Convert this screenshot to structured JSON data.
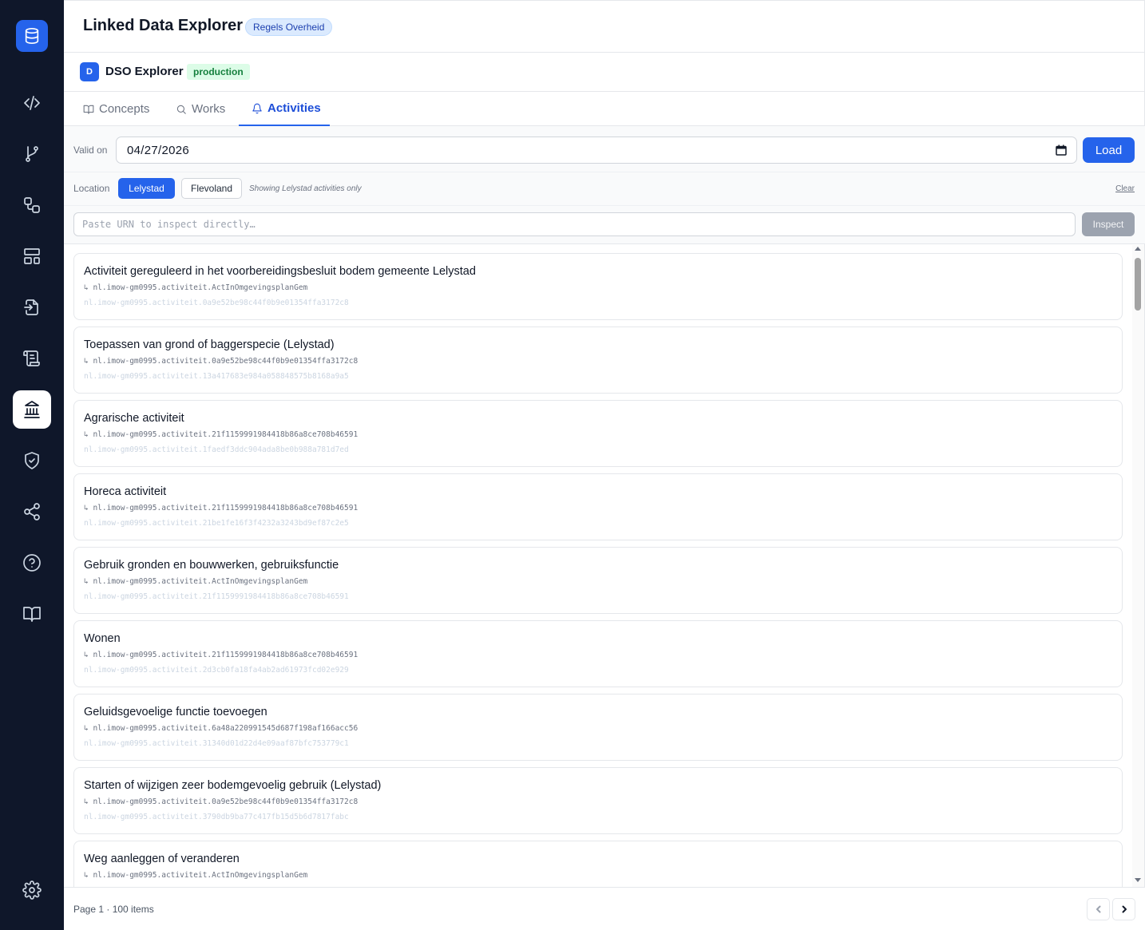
{
  "header": {
    "title": "Linked Data Explorer",
    "env_badge": "Regels Overheid"
  },
  "explorer": {
    "avatar_letter": "D",
    "name": "DSO Explorer",
    "stage_badge": "production"
  },
  "tabs": [
    {
      "label": "Concepts",
      "icon": "book-icon"
    },
    {
      "label": "Works",
      "icon": "search-icon"
    },
    {
      "label": "Activities",
      "icon": "bell-icon",
      "active": true
    }
  ],
  "controls": {
    "valid_on_label": "Valid on",
    "date_value": "04/27/2026",
    "load_label": "Load",
    "location_label": "Location",
    "locations": [
      "Lelystad",
      "Flevoland"
    ],
    "selected_location": "Lelystad",
    "location_note": "Showing Lelystad activities only",
    "clear_label": "Clear",
    "urn_placeholder": "Paste URN to inspect directly…",
    "inspect_label": "Inspect"
  },
  "activities": [
    {
      "title": "Activiteit gereguleerd in het voorbereidingsbesluit bodem gemeente Lelystad",
      "parent": "↳ nl.imow-gm0995.activiteit.ActInOmgevingsplanGem",
      "urn": "nl.imow-gm0995.activiteit.0a9e52be98c44f0b9e01354ffa3172c8"
    },
    {
      "title": "Toepassen van grond of baggerspecie (Lelystad)",
      "parent": "↳ nl.imow-gm0995.activiteit.0a9e52be98c44f0b9e01354ffa3172c8",
      "urn": "nl.imow-gm0995.activiteit.13a417683e984a058848575b8168a9a5"
    },
    {
      "title": "Agrarische activiteit",
      "parent": "↳ nl.imow-gm0995.activiteit.21f1159991984418b86a8ce708b46591",
      "urn": "nl.imow-gm0995.activiteit.1faedf3ddc904ada8be0b988a781d7ed"
    },
    {
      "title": "Horeca activiteit",
      "parent": "↳ nl.imow-gm0995.activiteit.21f1159991984418b86a8ce708b46591",
      "urn": "nl.imow-gm0995.activiteit.21be1fe16f3f4232a3243bd9ef87c2e5"
    },
    {
      "title": "Gebruik gronden en bouwwerken, gebruiksfunctie",
      "parent": "↳ nl.imow-gm0995.activiteit.ActInOmgevingsplanGem",
      "urn": "nl.imow-gm0995.activiteit.21f1159991984418b86a8ce708b46591"
    },
    {
      "title": "Wonen",
      "parent": "↳ nl.imow-gm0995.activiteit.21f1159991984418b86a8ce708b46591",
      "urn": "nl.imow-gm0995.activiteit.2d3cb0fa18fa4ab2ad61973fcd02e929"
    },
    {
      "title": "Geluidsgevoelige functie toevoegen",
      "parent": "↳ nl.imow-gm0995.activiteit.6a48a220991545d687f198af166acc56",
      "urn": "nl.imow-gm0995.activiteit.31340d01d22d4e09aaf87bfc753779c1"
    },
    {
      "title": "Starten of wijzigen zeer bodemgevoelig gebruik (Lelystad)",
      "parent": "↳ nl.imow-gm0995.activiteit.0a9e52be98c44f0b9e01354ffa3172c8",
      "urn": "nl.imow-gm0995.activiteit.3790db9ba77c417fb15d5b6d7817fabc"
    },
    {
      "title": "Weg aanleggen of veranderen",
      "parent": "↳ nl.imow-gm0995.activiteit.ActInOmgevingsplanGem",
      "urn": ""
    }
  ],
  "footer": {
    "page_info": "Page 1 · 100 items"
  },
  "sidebar": {
    "items": [
      {
        "icon": "code-icon"
      },
      {
        "icon": "git-branch-icon"
      },
      {
        "icon": "workflow-icon"
      },
      {
        "icon": "layout-icon"
      },
      {
        "icon": "file-import-icon"
      },
      {
        "icon": "scroll-icon"
      },
      {
        "icon": "landmark-icon",
        "active": true
      },
      {
        "icon": "shield-check-icon"
      },
      {
        "icon": "share-icon"
      },
      {
        "icon": "help-icon"
      },
      {
        "icon": "book-open-icon"
      },
      {
        "icon": "settings-icon"
      }
    ]
  },
  "colors": {
    "sidebar_bg": "#0f172a",
    "accent": "#2563eb",
    "production_bg": "#dcfce7",
    "production_text": "#15803d"
  }
}
